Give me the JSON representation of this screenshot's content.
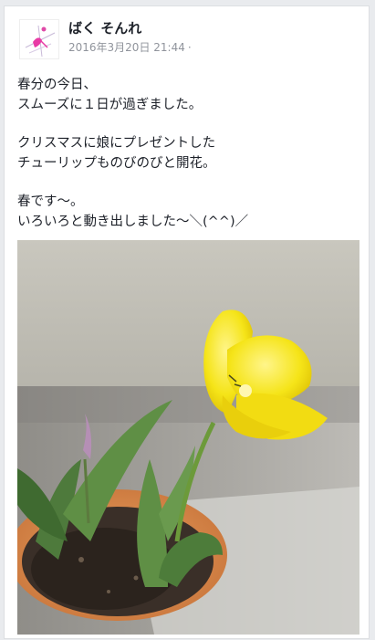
{
  "post": {
    "author": "ばく そんれ",
    "timestamp": "2016年3月20日 21:44",
    "separator": "·",
    "paragraphs": [
      [
        "春分の今日、",
        "スムーズに１日が過ぎました。"
      ],
      [
        "クリスマスに娘にプレゼントした",
        "チューリップものびのびと開花。"
      ],
      [
        "春です〜。",
        "いろいろと動き出しました〜＼(^^)／"
      ]
    ]
  },
  "colors": {
    "card_bg": "#ffffff",
    "page_bg": "#e9ebee",
    "name_text": "#1d2129",
    "meta_text": "#90949c"
  },
  "icons": {
    "avatar": "pink-figure-avatar-icon",
    "photo": "yellow-tulip-photo"
  }
}
